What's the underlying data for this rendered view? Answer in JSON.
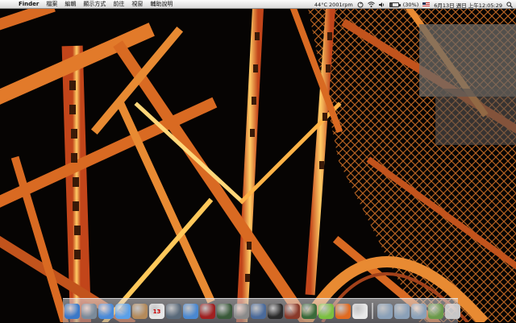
{
  "menubar": {
    "apple_glyph": "",
    "app_name": "Finder",
    "menus": [
      "檔案",
      "編輯",
      "顯示方式",
      "前往",
      "視窗",
      "輔助說明"
    ],
    "temp": "44°C 2001rpm",
    "battery_label": "(30%)",
    "battery_level": 0.3,
    "datetime": "6月13日 週日 上午12:05:29"
  },
  "dock": {
    "apps": [
      {
        "name": "finder",
        "color": "#3a78c8"
      },
      {
        "name": "preview",
        "color": "#7a8a9a"
      },
      {
        "name": "safari",
        "color": "#4a8ad8"
      },
      {
        "name": "ichat",
        "color": "#5aa0e8"
      },
      {
        "name": "address-book",
        "color": "#b48a5a"
      },
      {
        "name": "ical",
        "color": "#e8e8e8",
        "label": "13"
      },
      {
        "name": "iphoto",
        "color": "#5a6a7a"
      },
      {
        "name": "itunes",
        "color": "#4a88d0"
      },
      {
        "name": "photo-booth",
        "color": "#a02020"
      },
      {
        "name": "time-machine",
        "color": "#3a5a3a"
      },
      {
        "name": "system-preferences",
        "color": "#8a8a8a"
      },
      {
        "name": "xcode",
        "color": "#4a6a9a"
      },
      {
        "name": "terminal",
        "color": "#2a2a2a"
      },
      {
        "name": "dictionary",
        "color": "#8a3a2a"
      },
      {
        "name": "activity-monitor",
        "color": "#3a6a3a"
      },
      {
        "name": "android",
        "color": "#7ac040"
      },
      {
        "name": "firefox",
        "color": "#e06a20"
      },
      {
        "name": "script-editor",
        "color": "#e8e8e8"
      }
    ],
    "stacks": [
      {
        "name": "applications-folder",
        "color": "#8aa0b8"
      },
      {
        "name": "documents-folder",
        "color": "#8aa0b8"
      },
      {
        "name": "downloads-folder",
        "color": "#8aa0b8"
      },
      {
        "name": "desktop-stack",
        "color": "#6a9a4a"
      },
      {
        "name": "trash",
        "color": "#c8c8c8"
      }
    ]
  },
  "colors": {
    "lattice": "#f08a2a",
    "lattice_bright": "#ffd070",
    "sky": "#050403"
  }
}
